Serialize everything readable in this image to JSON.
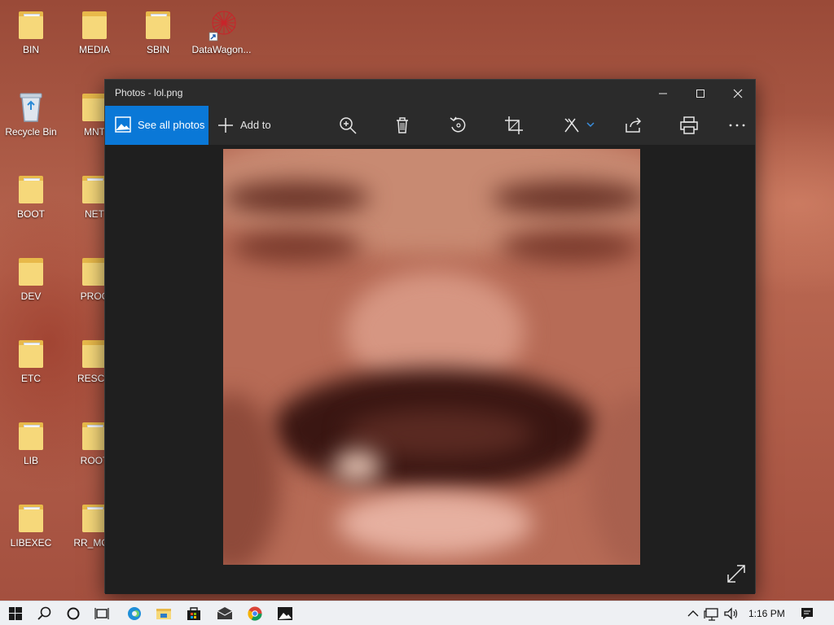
{
  "desktop": {
    "icons": [
      {
        "label": "BIN"
      },
      {
        "label": "MEDIA"
      },
      {
        "label": "SBIN"
      },
      {
        "label": "DataWagon..."
      },
      {
        "label": "Recycle Bin"
      },
      {
        "label": "MNT"
      },
      {
        "label": "BOOT"
      },
      {
        "label": "NET"
      },
      {
        "label": "DEV"
      },
      {
        "label": "PROC"
      },
      {
        "label": "ETC"
      },
      {
        "label": "RESCU"
      },
      {
        "label": "LIB"
      },
      {
        "label": "ROOT"
      },
      {
        "label": "LIBEXEC"
      },
      {
        "label": "RR_MOV"
      }
    ]
  },
  "window": {
    "title": "Photos - lol.png",
    "controls": {
      "minimize": "—",
      "maximize": "☐",
      "close": "✕"
    },
    "toolbar": {
      "see_all_photos": "See all photos",
      "add_to": "Add to",
      "tools": [
        {
          "icon": "zoom-in-icon"
        },
        {
          "icon": "delete-icon"
        },
        {
          "icon": "rotate-icon"
        },
        {
          "icon": "crop-icon"
        },
        {
          "icon": "edit-icon"
        },
        {
          "icon": "share-icon"
        },
        {
          "icon": "print-icon"
        },
        {
          "icon": "more-icon"
        }
      ]
    },
    "image_file": "lol.png"
  },
  "taskbar": {
    "clock": "1:16 PM",
    "accent": "#0a78d7"
  }
}
